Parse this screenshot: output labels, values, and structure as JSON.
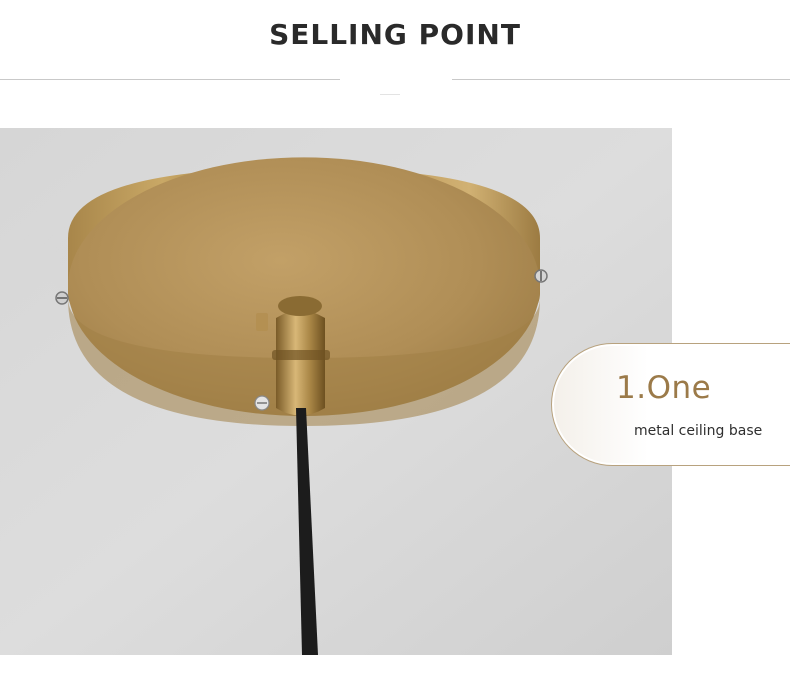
{
  "header": {
    "title": "SELLING POINT"
  },
  "callout": {
    "title": "1.One",
    "subtitle": "metal ceiling base"
  },
  "colors": {
    "accent_gold": "#9b7a49",
    "border_gold": "#b8a27e",
    "ceiling_gray": "#d9d9d9",
    "brass": "#b08d4a",
    "cord": "#1c1c1c"
  },
  "photo": {
    "subject": "brass-ceiling-canopy-with-black-cord-icon"
  }
}
